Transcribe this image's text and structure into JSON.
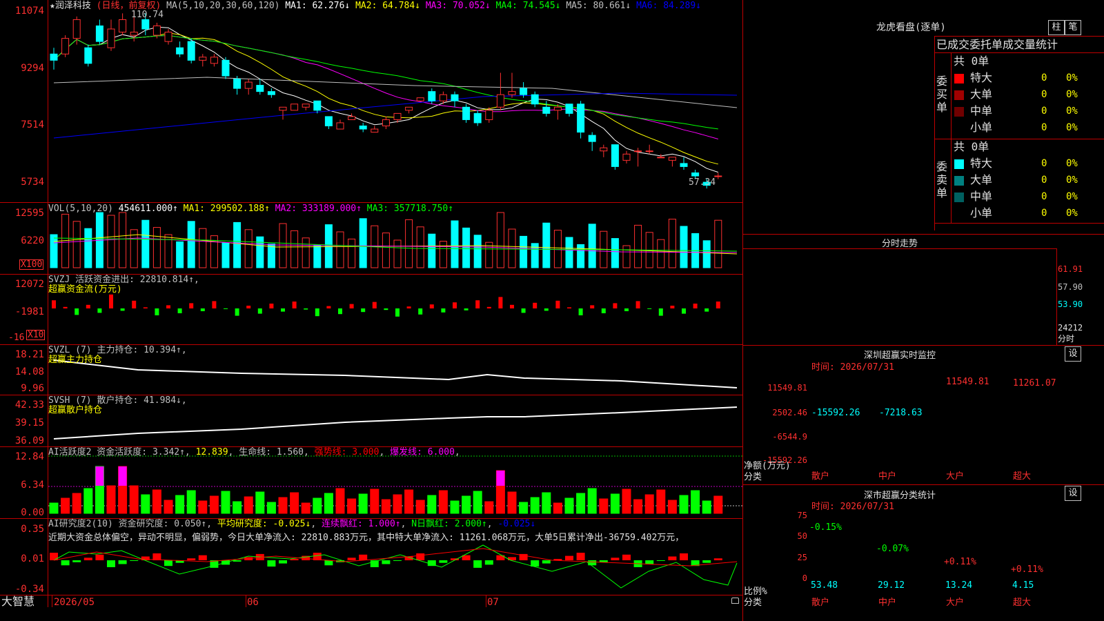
{
  "stock": {
    "title": "★润泽科技",
    "period": "(日线，前复权)",
    "ma_header": "MA(5,10,20,30,60,120)"
  },
  "main_ma": [
    {
      "label": "MA1: 62.276↓",
      "color": "#ffffff"
    },
    {
      "label": "MA2: 64.784↓",
      "color": "#ffff00"
    },
    {
      "label": "MA3: 70.052↓",
      "color": "#ff00ff"
    },
    {
      "label": "MA4: 74.545↓",
      "color": "#00ff00"
    },
    {
      "label": "MA5: 80.661↓",
      "color": "#c0c0c0"
    },
    {
      "label": "MA6: 84.289↓",
      "color": "#0000ff"
    }
  ],
  "main_yaxis": [
    "11074",
    "9294",
    "7514",
    "5734"
  ],
  "high_marker": "110.74",
  "low_marker": "57.34",
  "vol": {
    "header": "VOL(5,10,20)",
    "value": "454611.000↑",
    "ma": [
      {
        "label": "MA1: 299502.188↑",
        "color": "#ffff00"
      },
      {
        "label": "MA2: 333189.000↑",
        "color": "#ff00ff"
      },
      {
        "label": "MA3: 357718.750↑",
        "color": "#00ff00"
      }
    ],
    "yaxis": [
      "12595",
      "6220"
    ],
    "unit": "X100"
  },
  "svzj": {
    "header": "SVZJ  活跃资金进出: 22810.814↑,",
    "sub": "超赢资金流(万元)",
    "yaxis": [
      "12072",
      "-1981",
      "-16"
    ],
    "unit": "X10"
  },
  "svzl": {
    "header": "SVZL (7) 主力持仓: 10.394↑,",
    "sub": "超赢主力持仓",
    "yaxis": [
      "18.21",
      "14.08",
      "9.96"
    ]
  },
  "svsh": {
    "header": "SVSH (7) 散户持仓: 41.984↓,",
    "sub": "超赢散户持仓",
    "yaxis": [
      "42.33",
      "39.15",
      "36.09"
    ]
  },
  "ai1": {
    "header": "AI活跃度2 资金活跃度: 3.342↑",
    "v2": "12.839",
    "life": "生命线: 1.560",
    "strong": "强势线: 3.000",
    "burst": "爆发线: 6.000",
    "yaxis": [
      "12.84",
      "6.34",
      "0.00"
    ]
  },
  "ai2": {
    "header": "AI研究度2(10) 资金研究度: 0.050↑",
    "avg": "平均研究度: -0.025↓",
    "red": "连续飘红: 1.000↑",
    "nred": "N日飘红: 2.000↑",
    "tail": "-0.025↓",
    "comment": "近期大资金总体偏空，异动不明显，偏弱势，今日大单净流入: 22810.883万元，其中特大单净流入: 11261.068万元，大单5日累计净出-36759.402万元，",
    "yaxis": [
      "0.35",
      "0.01",
      "-0.34"
    ]
  },
  "xaxis": {
    "brand": "大智慧",
    "labels": [
      "2026/05",
      "06",
      "07"
    ]
  },
  "dragon": {
    "title": "龙虎看盘(逐单)",
    "btn1": "柱",
    "btn2": "笔",
    "subtitle": "已成交委托单成交量统计",
    "buy_label": "委买单",
    "sell_label": "委卖单",
    "buy_total": "共 0单",
    "sell_total": "共 0单",
    "buy_rows": [
      {
        "name": "特大",
        "count": "0",
        "pct": "0%",
        "color": "#ff0000"
      },
      {
        "name": "大单",
        "count": "0",
        "pct": "0%",
        "color": "#a00000"
      },
      {
        "name": "中单",
        "count": "0",
        "pct": "0%",
        "color": "#700000"
      },
      {
        "name": "小单",
        "count": "0",
        "pct": "0%",
        "color": ""
      }
    ],
    "sell_rows": [
      {
        "name": "特大",
        "count": "0",
        "pct": "0%",
        "color": "#00ffff"
      },
      {
        "name": "大单",
        "count": "0",
        "pct": "0%",
        "color": "#008080"
      },
      {
        "name": "中单",
        "count": "0",
        "pct": "0%",
        "color": "#006060"
      },
      {
        "name": "小单",
        "count": "0",
        "pct": "0%",
        "color": ""
      }
    ]
  },
  "intraday": {
    "title": "分时走势",
    "yaxis": [
      "61.91",
      "57.90",
      "53.90"
    ],
    "vol": "24212",
    "unit": "分时"
  },
  "sz_monitor": {
    "title": "深圳超赢实时监控",
    "btn": "设",
    "time": "时间: 2026/07/31",
    "yaxis": [
      "11549.81",
      "2502.46",
      "-6544.9",
      "-15592.26"
    ],
    "ylabel": "净额(万元)",
    "xlabel": "分类",
    "categories": [
      "散户",
      "中户",
      "大户",
      "超大"
    ],
    "values": [
      -15592.26,
      -7218.63,
      11549.81,
      11261.07
    ],
    "value_labels": [
      "-15592.26",
      "-7218.63",
      "11549.81",
      "11261.07"
    ]
  },
  "sz_classify": {
    "title": "深市超赢分类统计",
    "btn": "设",
    "time": "时间: 2026/07/31",
    "yaxis": [
      "75",
      "50",
      "25",
      "0"
    ],
    "ylabel": "比例%",
    "xlabel": "分类",
    "categories": [
      "散户",
      "中户",
      "大户",
      "超大"
    ],
    "values": [
      53.48,
      29.12,
      13.24,
      4.15
    ],
    "bottom_labels": [
      "53.48",
      "29.12",
      "13.24",
      "4.15"
    ],
    "top_labels": [
      "-0.15%",
      "-0.07%",
      "+0.11%",
      "+0.11%"
    ]
  },
  "candles": [
    [
      97,
      95,
      99,
      92
    ],
    [
      97,
      102,
      103,
      96
    ],
    [
      102,
      108,
      109,
      100
    ],
    [
      99,
      94,
      100,
      93
    ],
    [
      106,
      101,
      108,
      100
    ],
    [
      99,
      105,
      108,
      98
    ],
    [
      104,
      108,
      110,
      103
    ],
    [
      103,
      104,
      111,
      101
    ],
    [
      108,
      105,
      110,
      103
    ],
    [
      103,
      106,
      107,
      102
    ],
    [
      101,
      104,
      105,
      100
    ],
    [
      99,
      97,
      101,
      96
    ],
    [
      101,
      95,
      102,
      94
    ],
    [
      95,
      96,
      97,
      93
    ],
    [
      94,
      96,
      97,
      93
    ],
    [
      95,
      90,
      96,
      89
    ],
    [
      89,
      86,
      90,
      84
    ],
    [
      86,
      88,
      89,
      84
    ],
    [
      87,
      85,
      89,
      84
    ],
    [
      85,
      84,
      86,
      83
    ],
    [
      79,
      80,
      80,
      76
    ],
    [
      79,
      81,
      81,
      79
    ],
    [
      80,
      81,
      81,
      79
    ],
    [
      82,
      79,
      82,
      78
    ],
    [
      77,
      74,
      77,
      73
    ],
    [
      73,
      75,
      76,
      73
    ],
    [
      76,
      77,
      78,
      76
    ],
    [
      74,
      73,
      75,
      72
    ],
    [
      72,
      73,
      74,
      72
    ],
    [
      74,
      76,
      77,
      73
    ],
    [
      76,
      78,
      78,
      75
    ],
    [
      79,
      80,
      80,
      78
    ],
    [
      82,
      83,
      83,
      82
    ],
    [
      85,
      82,
      86,
      81
    ],
    [
      82,
      84,
      85,
      81
    ],
    [
      84,
      82,
      85,
      80
    ],
    [
      80,
      76,
      81,
      75
    ],
    [
      78,
      75,
      79,
      74
    ],
    [
      76,
      79,
      80,
      75
    ],
    [
      80,
      84,
      91,
      79
    ],
    [
      84,
      85,
      91,
      83
    ],
    [
      86,
      84,
      88,
      83
    ],
    [
      84,
      81,
      85,
      80
    ],
    [
      80,
      78,
      82,
      77
    ],
    [
      79,
      80,
      81,
      76
    ],
    [
      81,
      78,
      81,
      77
    ],
    [
      81,
      72,
      82,
      70
    ],
    [
      71,
      69,
      72,
      66
    ],
    [
      66,
      67,
      68,
      64
    ],
    [
      68,
      61,
      68,
      60
    ],
    [
      63,
      65,
      66,
      62
    ],
    [
      66,
      66,
      67,
      61
    ],
    [
      66,
      66,
      68,
      65
    ],
    [
      64,
      64,
      65,
      64
    ],
    [
      63,
      64,
      64,
      61
    ],
    [
      62,
      61,
      64,
      60
    ],
    [
      59,
      58,
      60,
      57
    ],
    [
      56,
      55,
      57,
      54
    ],
    [
      58,
      58,
      59,
      57
    ]
  ]
}
